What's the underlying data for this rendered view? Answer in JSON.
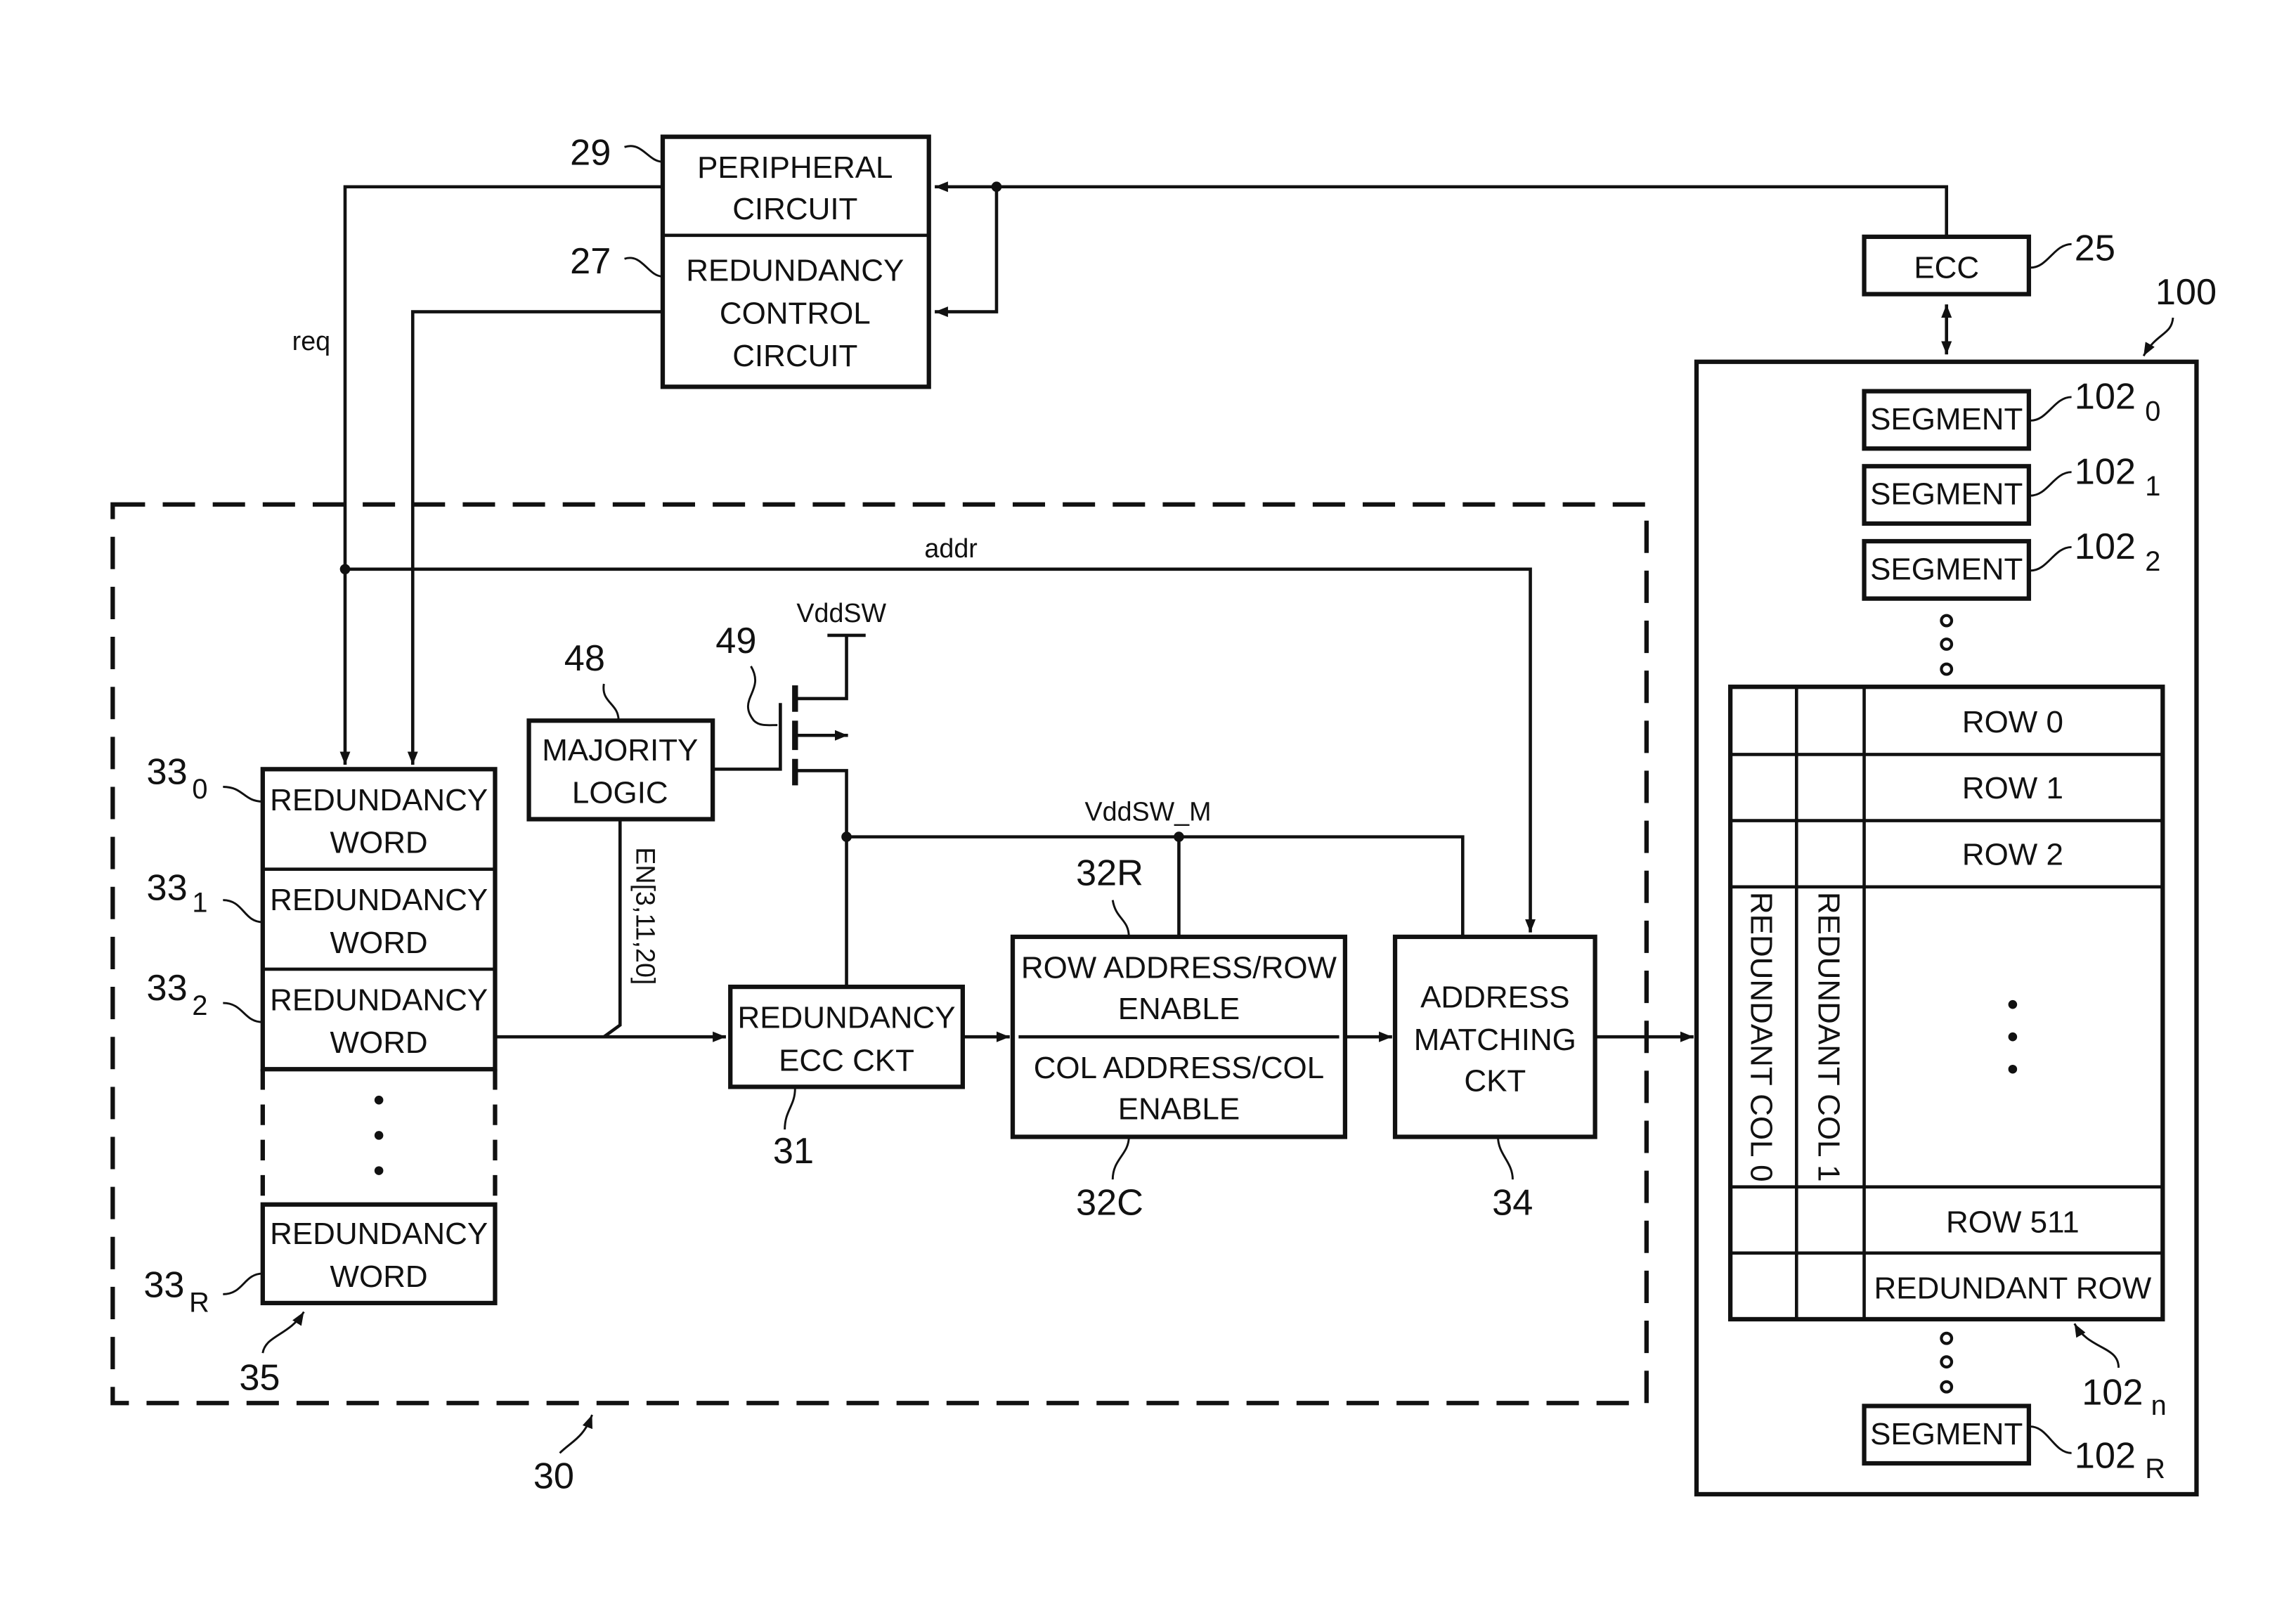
{
  "blocks": {
    "peripheral": {
      "ref": "29",
      "lines": [
        "PERIPHERAL",
        "CIRCUIT"
      ]
    },
    "redundancy_control": {
      "ref": "27",
      "lines": [
        "REDUNDANCY",
        "CONTROL",
        "CIRCUIT"
      ]
    },
    "ecc": {
      "ref": "25",
      "label": "ECC"
    },
    "majority_logic": {
      "ref": "48",
      "lines": [
        "MAJORITY",
        "LOGIC"
      ]
    },
    "transistor": {
      "ref": "49"
    },
    "redundancy_ecc": {
      "ref": "31",
      "lines": [
        "REDUNDANCY",
        "ECC CKT"
      ]
    },
    "row_addr": {
      "ref": "32R",
      "lines": [
        "ROW ADDRESS/ROW",
        "ENABLE"
      ]
    },
    "col_addr": {
      "ref": "32C",
      "lines": [
        "COL ADDRESS/COL",
        "ENABLE"
      ]
    },
    "address_matching": {
      "ref": "34",
      "lines": [
        "ADDRESS",
        "MATCHING",
        "CKT"
      ]
    },
    "redundancy_module": {
      "ref": "30"
    },
    "word_stack": {
      "ref": "35"
    }
  },
  "redundancy_words": [
    {
      "ref": "33",
      "sub": "0",
      "lines": [
        "REDUNDANCY",
        "WORD"
      ]
    },
    {
      "ref": "33",
      "sub": "1",
      "lines": [
        "REDUNDANCY",
        "WORD"
      ]
    },
    {
      "ref": "33",
      "sub": "2",
      "lines": [
        "REDUNDANCY",
        "WORD"
      ]
    },
    {
      "ref": "33",
      "sub": "R",
      "lines": [
        "REDUNDANCY",
        "WORD"
      ]
    }
  ],
  "signals": {
    "req": "req",
    "addr": "addr",
    "vddsw": "VddSW",
    "vddsw_m": "VddSW_M",
    "en": "EN[3,11,20]"
  },
  "memory": {
    "ref": "100",
    "segments": [
      {
        "label": "SEGMENT",
        "ref": "102",
        "sub": "0"
      },
      {
        "label": "SEGMENT",
        "ref": "102",
        "sub": "1"
      },
      {
        "label": "SEGMENT",
        "ref": "102",
        "sub": "2"
      },
      {
        "label": "SEGMENT",
        "ref": "102",
        "sub": "R"
      }
    ],
    "array": {
      "ref": "102",
      "sub": "n",
      "rows": [
        "ROW 0",
        "ROW 1",
        "ROW 2",
        "ROW 511",
        "REDUNDANT ROW"
      ],
      "redundant_cols": [
        "REDUNDANT COL 0",
        "REDUNDANT COL 1"
      ]
    }
  }
}
